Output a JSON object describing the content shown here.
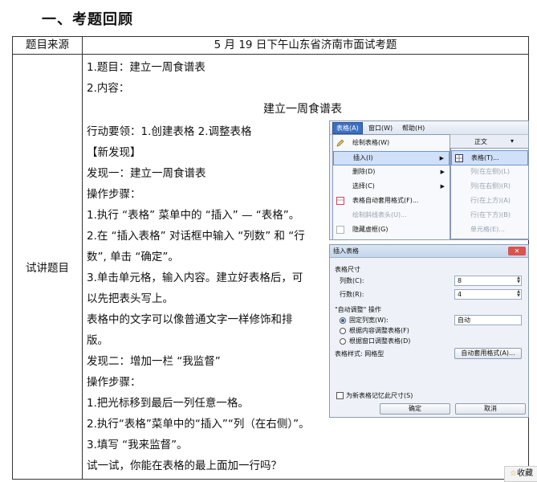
{
  "heading": "一、考题回顾",
  "table": {
    "row1_label": "题目来源",
    "row1_value": "5 月 19 日下午山东省济南市面试考题",
    "row2_label": "试讲题目"
  },
  "content": {
    "lines": [
      "1.题目：建立一周食谱表",
      "2.内容：",
      "行动要领：1.创建表格 2.调整表格",
      "【新发现】",
      "发现一：建立一周食谱表",
      "操作步骤：",
      "1.执行 “表格” 菜单中的 “插入” — “表格”。",
      "2.在 “插入表格” 对话框中输入 “列数” 和 “行",
      "数”, 单击 “确定”。",
      "3.单击单元格，输入内容。建立好表格后，可",
      "以先把表头写上。",
      "表格中的文字可以像普通文字一样修饰和排",
      "版。",
      "发现二：增加一栏 “我监督”",
      "操作步骤：",
      "1.把光标移到最后一列任意一格。",
      "2.执行“表格”菜单中的“插入”“列（在右侧）”。",
      "3.填写 “我来监督”。",
      "试一试，你能在表格的最上面加一行吗？"
    ],
    "center_title": "建立一周食谱表"
  },
  "menu_shot": {
    "menubar": [
      "表格(A)",
      "窗口(W)",
      "帮助(H)"
    ],
    "toolbar_text": "正文",
    "dropdown": [
      "绘制表格(W)",
      "插入(I)",
      "删除(D)",
      "选择(C)",
      "表格自动套用格式(F)...",
      "绘制斜线表头(U)...",
      "隐藏虚框(G)"
    ],
    "submenu": [
      "表格(T)...",
      "列(在左侧)(L)",
      "列(在右侧)(R)",
      "行(在上方)(A)",
      "行(在下方)(B)",
      "单元格(E)..."
    ]
  },
  "dialog": {
    "title": "插入表格",
    "size_group": "表格尺寸",
    "cols_label": "列数(C):",
    "cols_value": "8",
    "rows_label": "行数(R):",
    "rows_value": "4",
    "autofit_group": "\"自动调整\" 操作",
    "opt1": "固定列宽(W):",
    "opt1_value": "自动",
    "opt2": "根据内容调整表格(F)",
    "opt3": "根据窗口调整表格(D)",
    "style_label": "表格样式: 网格型",
    "autoformat_btn": "自动套用格式(A)...",
    "remember": "为新表格记忆此尺寸(S)",
    "ok": "确定",
    "cancel": "取消"
  },
  "collect_label": "收藏"
}
